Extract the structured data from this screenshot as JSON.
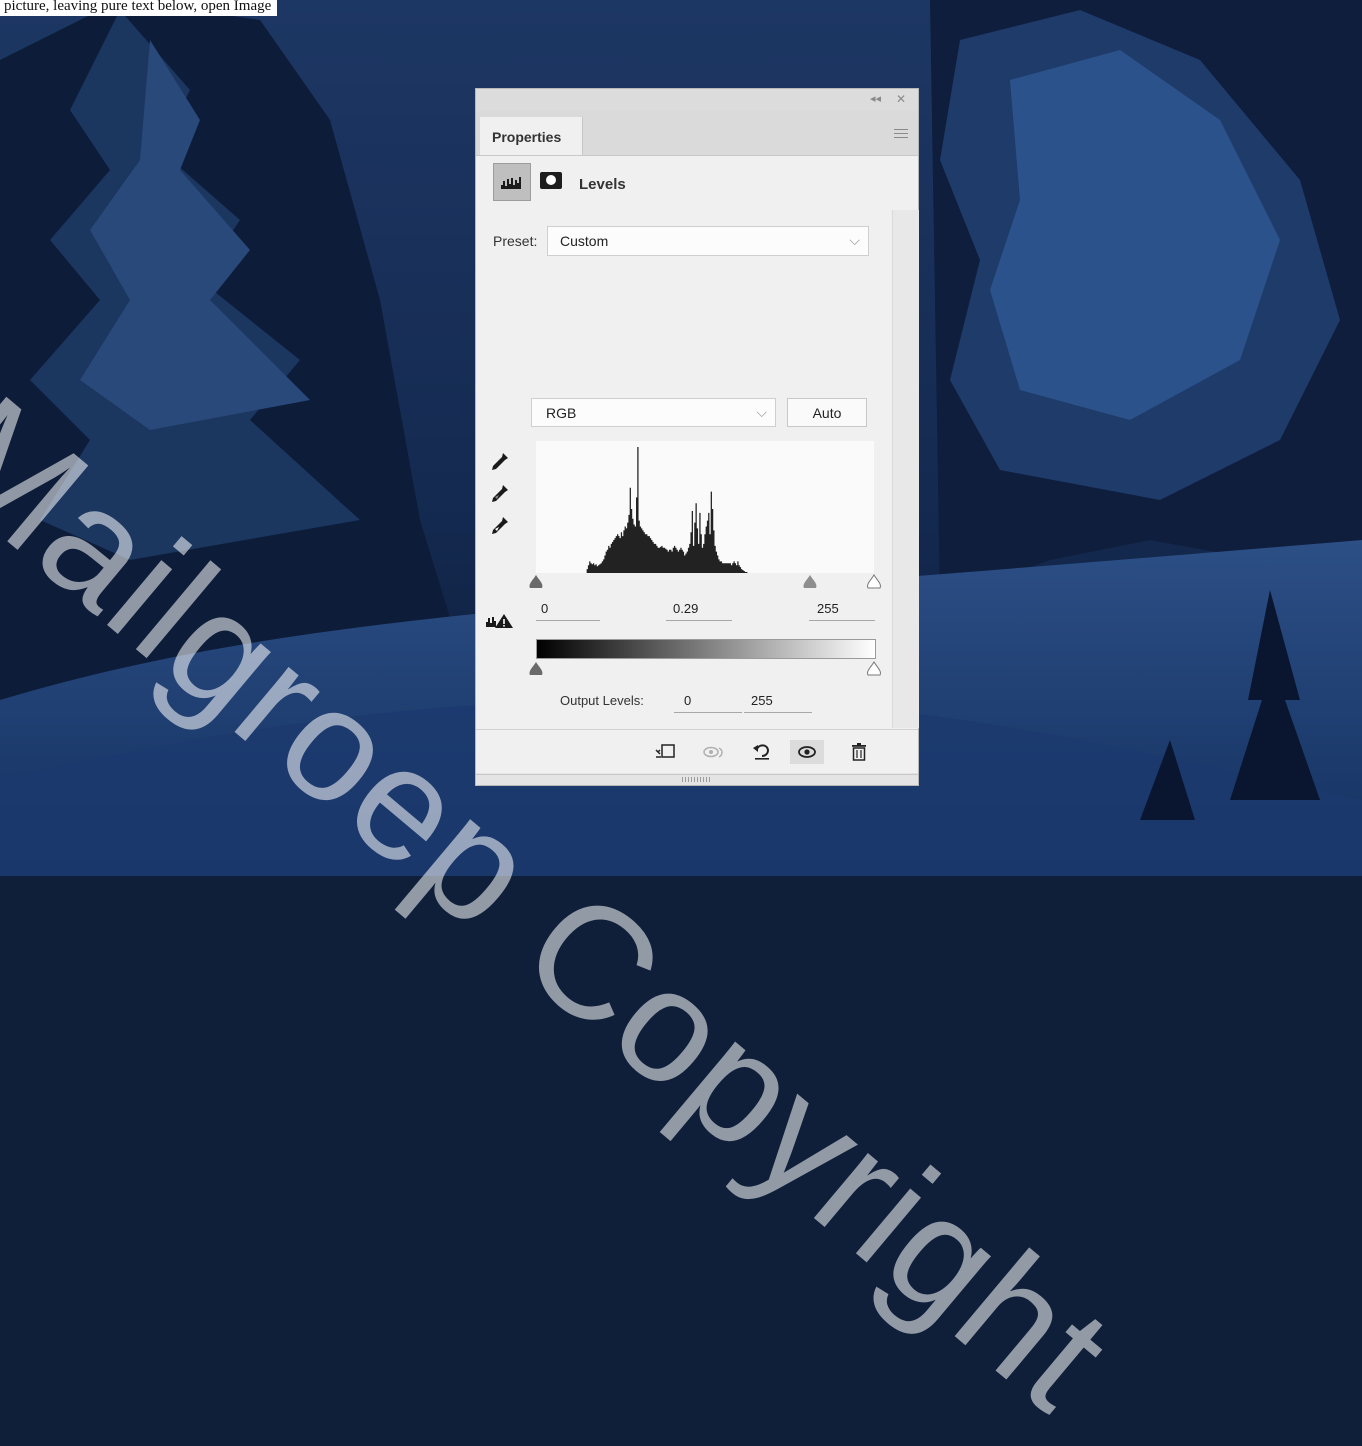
{
  "caption": "picture, leaving pure text below, open Image",
  "watermark": "Mailgroep Copyright",
  "panel": {
    "tab_label": "Properties",
    "adjustment_title": "Levels",
    "preset_label": "Preset:",
    "preset_value": "Custom",
    "channel_value": "RGB",
    "auto_label": "Auto",
    "input_black": "0",
    "input_gamma": "0.29",
    "input_white": "255",
    "output_label": "Output Levels:",
    "output_black": "0",
    "output_white": "255"
  },
  "icons": {
    "collapse": "double-chevron-left-icon",
    "close": "close-icon",
    "menu": "panel-menu-icon",
    "histogram": "levels-histogram-icon",
    "mask": "layer-mask-icon",
    "eyedropper_black": "black-point-eyedropper-icon",
    "eyedropper_gray": "gray-point-eyedropper-icon",
    "eyedropper_white": "white-point-eyedropper-icon",
    "clipping_warning": "clipping-warning-icon",
    "clip_to_layer": "clip-to-layer-icon",
    "view_previous": "view-previous-state-icon",
    "reset": "reset-icon",
    "visibility": "eye-icon",
    "delete": "trash-icon"
  },
  "colors": {
    "panel_bg": "#f0f0f0",
    "histogram_fill": "#222222",
    "slider_gray": "#7a7a7a"
  },
  "histogram_levels": [
    0,
    0,
    0,
    0,
    0,
    0,
    0,
    0,
    0,
    0,
    0,
    0,
    0,
    0,
    0,
    0,
    0,
    0,
    0,
    0,
    0,
    0,
    0,
    0,
    0,
    0,
    0,
    0,
    0,
    0,
    0,
    0,
    0,
    0,
    0,
    0,
    0,
    0,
    0,
    0,
    4,
    8,
    12,
    10,
    9,
    10,
    8,
    9,
    7,
    8,
    9,
    10,
    12,
    14,
    18,
    22,
    24,
    28,
    26,
    30,
    32,
    34,
    36,
    38,
    40,
    38,
    36,
    42,
    38,
    44,
    48,
    46,
    52,
    60,
    88,
    66,
    56,
    50,
    48,
    78,
    130,
    54,
    48,
    46,
    44,
    42,
    40,
    40,
    38,
    38,
    36,
    34,
    32,
    30,
    30,
    28,
    26,
    26,
    27,
    28,
    26,
    26,
    25,
    24,
    22,
    24,
    24,
    22,
    26,
    28,
    26,
    24,
    22,
    24,
    26,
    24,
    22,
    18,
    20,
    22,
    26,
    30,
    42,
    64,
    28,
    52,
    72,
    46,
    30,
    62,
    40,
    26,
    30,
    40,
    48,
    54,
    62,
    40,
    84,
    66,
    44,
    28,
    22,
    18,
    14,
    12,
    12,
    10,
    10,
    10,
    10,
    10,
    10,
    10,
    8,
    10,
    12,
    10,
    8,
    12,
    8,
    6,
    4,
    3,
    2,
    1,
    1,
    0,
    0,
    0,
    0,
    0,
    0,
    0,
    0,
    0,
    0,
    0,
    0,
    0,
    0,
    0,
    0,
    0,
    0,
    0,
    0,
    0,
    0,
    0,
    0,
    0,
    0,
    0,
    0,
    0,
    0,
    0,
    0,
    0,
    0,
    0,
    0,
    0,
    0,
    0,
    0,
    0,
    0,
    0,
    0,
    0,
    0,
    0,
    0,
    0,
    0,
    0,
    0,
    0,
    0,
    0,
    0,
    0,
    0,
    0,
    0,
    0,
    0,
    0,
    0,
    0,
    0,
    0,
    0,
    0,
    0,
    0,
    0,
    0,
    0,
    0,
    0,
    0,
    0,
    0,
    0,
    0,
    0,
    0,
    0,
    0,
    0,
    0,
    0,
    0,
    0,
    0,
    0,
    0,
    0,
    0,
    0,
    0,
    0,
    0,
    0
  ],
  "input_slider_fractions": {
    "black": 0.0,
    "gamma": 0.812,
    "white": 1.0
  },
  "output_slider_fractions": {
    "black": 0.0,
    "white": 1.0
  }
}
